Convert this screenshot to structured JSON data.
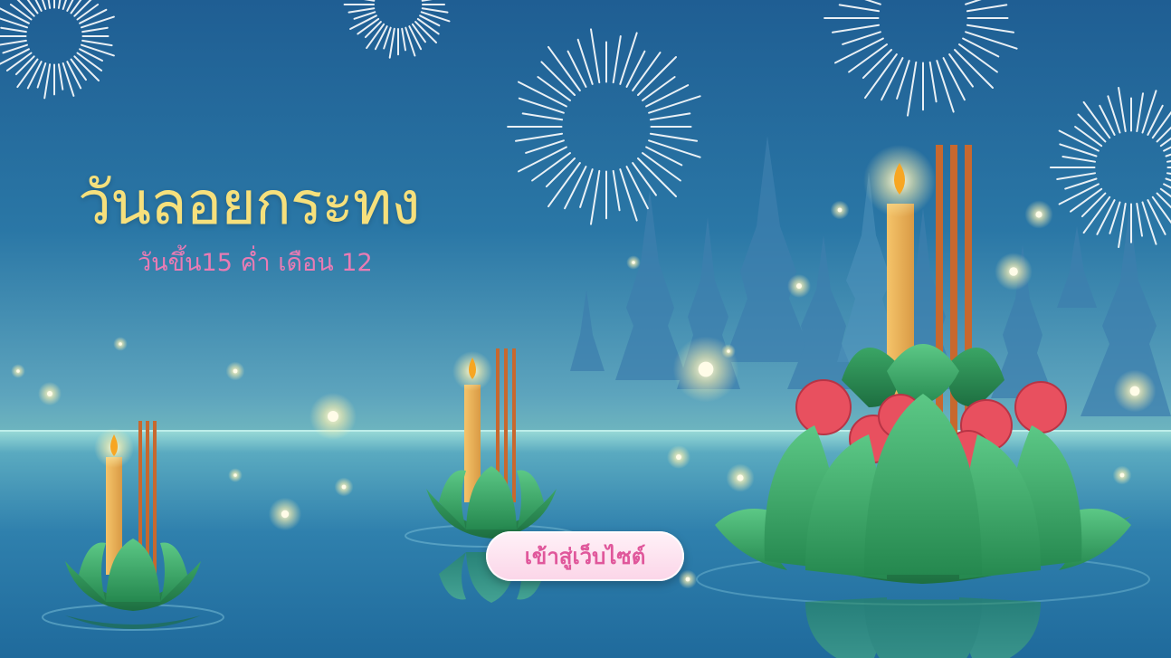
{
  "hero": {
    "title": "วันลอยกระทง",
    "subtitle": "วันขึ้น15 ค่ำ เดือน 12"
  },
  "cta": {
    "label": "เข้าสู่เว็บไซต์"
  },
  "colors": {
    "title": "#f6e07c",
    "subtitle": "#e97bb4",
    "button_text": "#e0579b",
    "sky_top": "#1f5e93",
    "leaf": "#3fae6a",
    "rose": "#e8505f"
  },
  "decorations": {
    "fireworks_icon": "firework-icon",
    "temple_icon": "temple-silhouette-icon",
    "krathong_icon": "krathong-icon"
  }
}
